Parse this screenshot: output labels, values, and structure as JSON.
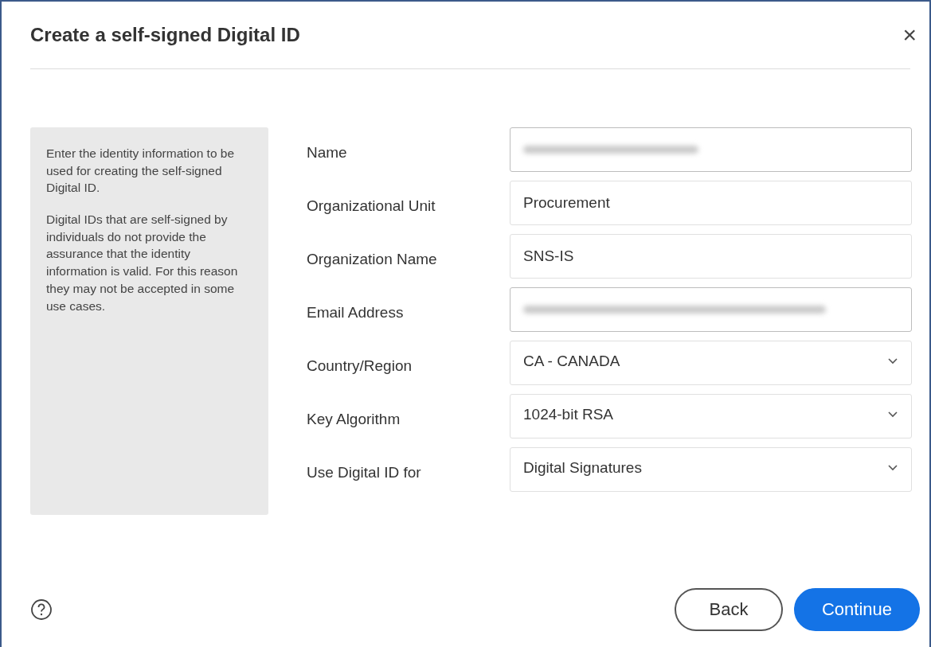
{
  "dialog": {
    "title": "Create a self-signed Digital ID",
    "close": "×"
  },
  "info": {
    "paragraphs": [
      "Enter the identity information to be used for creating the self-signed Digital ID.",
      "Digital IDs that are self-signed by individuals do not provide the assurance that the identity information is valid. For this reason they may not be accepted in some use cases."
    ]
  },
  "fields": [
    {
      "label": "Name",
      "kind": "text",
      "redacted": true
    },
    {
      "label": "Organizational Unit",
      "kind": "text",
      "value": "Procurement",
      "redacted": false
    },
    {
      "label": "Organization Name",
      "kind": "text",
      "value": "SNS-IS",
      "redacted": false
    },
    {
      "label": "Email Address",
      "kind": "text",
      "redacted": true
    },
    {
      "label": "Country/Region",
      "kind": "dropdown",
      "value": "CA - CANADA"
    },
    {
      "label": "Key Algorithm",
      "kind": "dropdown",
      "value": "1024-bit RSA"
    },
    {
      "label": "Use Digital ID for",
      "kind": "dropdown",
      "value": "Digital Signatures"
    }
  ],
  "buttons": [
    {
      "label": "Back",
      "kind": "secondary"
    },
    {
      "label": "Continue",
      "kind": "primary"
    }
  ]
}
